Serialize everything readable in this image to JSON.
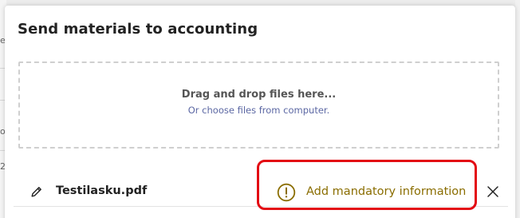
{
  "background": {
    "fragments": [
      "er",
      "o",
      "2"
    ]
  },
  "modal": {
    "title": "Send materials to accounting",
    "dropzone": {
      "primary_text": "Drag and drop files here...",
      "secondary_text": "Or choose files from computer."
    },
    "files": [
      {
        "name": "Testilasku.pdf",
        "status_text": "Add mandatory information",
        "status_icon": "warning-circle-icon",
        "edit_icon": "pencil-icon",
        "remove_icon": "close-icon"
      }
    ]
  },
  "colors": {
    "warning": "#8a6d00",
    "link": "#5b67a3",
    "highlight": "#e30b13"
  }
}
